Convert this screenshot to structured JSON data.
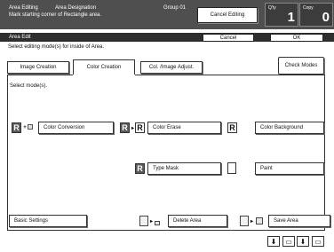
{
  "header": {
    "area_editing": "Area Editing",
    "area_designation": "Area Designation",
    "instruction": "Mark starting corner of Rectangle area.",
    "group": "Group 01",
    "cancel_editing": "Cancel Editing",
    "qty_label": "Q'ty",
    "qty_value": "1",
    "copy_label": "Copy",
    "copy_value": "0"
  },
  "edit_bar": {
    "label": "Area Edit",
    "cancel": "Cancel",
    "ok": "OK"
  },
  "instruction": "Select editing mode(s) for inside of Area.",
  "tabs": [
    {
      "label": "Image Creation",
      "active": false
    },
    {
      "label": "Color Creation",
      "active": true
    },
    {
      "label": "Col. /Image Adjust.",
      "active": false
    }
  ],
  "check_modes": "Check Modes",
  "select_modes": "Select mode(s).",
  "modes": {
    "color_conversion": "Color Conversion",
    "color_erase": "Color Erase",
    "color_background": "Color Background",
    "type_mask": "Type Mask",
    "paint": "Paint"
  },
  "icon_letter": "R",
  "bottom": {
    "basic_settings": "Basic Settings",
    "delete_area": "Delete Area",
    "save_area": "Save Area"
  },
  "icons": [
    "down-arrow-icon",
    "image-icon",
    "scroll-down-icon"
  ]
}
